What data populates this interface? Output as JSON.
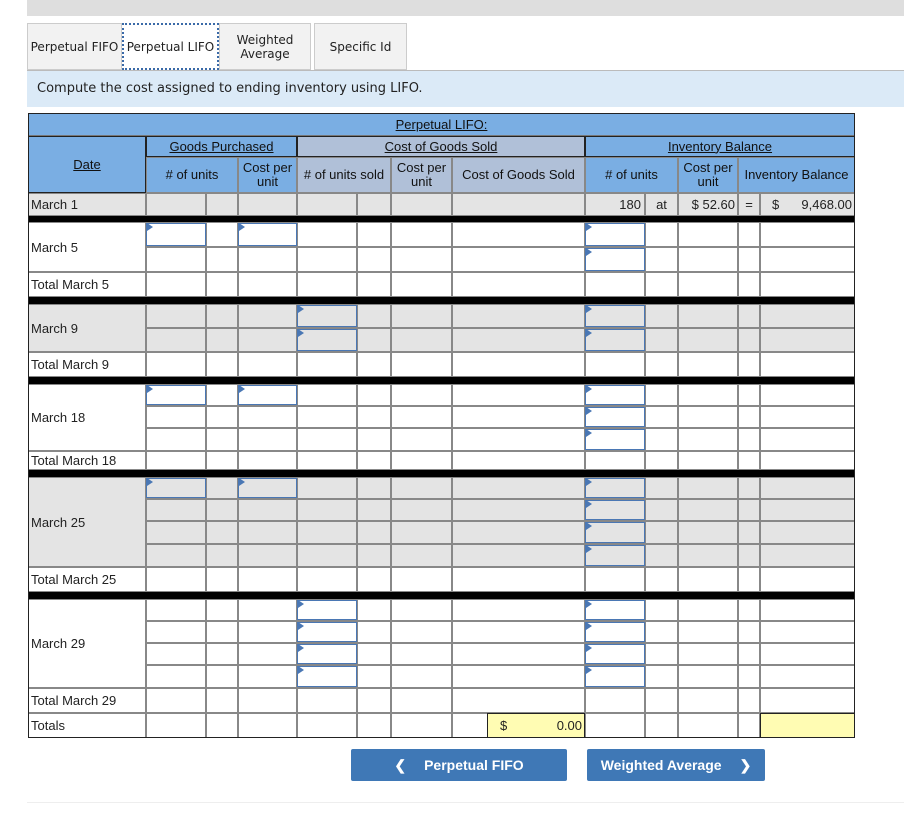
{
  "tabs": [
    {
      "label": "Perpetual FIFO"
    },
    {
      "label": "Perpetual LIFO",
      "active": true
    },
    {
      "label": "Weighted Average"
    },
    {
      "label": "Specific Id"
    }
  ],
  "instruction": "Compute the cost assigned to ending inventory using LIFO.",
  "table": {
    "title": "Perpetual LIFO:",
    "groups": {
      "purchased": "Goods Purchased",
      "cogs": "Cost of Goods Sold",
      "balance": "Inventory Balance"
    },
    "headers": {
      "date": "Date",
      "units": "# of units",
      "cost_per_unit": "Cost per unit",
      "units_sold": "# of units sold",
      "cogs_cost_per_unit": "Cost per unit",
      "cogs": "Cost of Goods Sold",
      "bal_units": "# of units",
      "bal_cost_per_unit": "Cost per unit",
      "bal_total": "Inventory Balance"
    },
    "march1": {
      "label": "March 1",
      "units": "180",
      "at": "at",
      "cost": "$ 52.60",
      "eq": "=",
      "cur": "$",
      "balance": "9,468.00"
    },
    "rows": {
      "m5": "March 5",
      "t5": "Total March 5",
      "m9": "March 9",
      "t9": "Total March 9",
      "m18": "March 18",
      "t18": "Total March 18",
      "m25": "March 25",
      "t25": "Total March 25",
      "m29": "March 29",
      "t29": "Total March 29",
      "totals": "Totals"
    },
    "totals": {
      "cogs_cur": "$",
      "cogs_value": "0.00"
    }
  },
  "colors": {
    "header": "#7aaee3",
    "cogs_header": "#b0c0d8",
    "gray_row": "#e4e4e4",
    "total_fill": "#fffcb3",
    "button": "#3f78b6"
  },
  "nav": {
    "prev": "Perpetual FIFO",
    "next": "Weighted Average",
    "prev_icon": "chevron-left-icon",
    "next_icon": "chevron-right-icon"
  }
}
